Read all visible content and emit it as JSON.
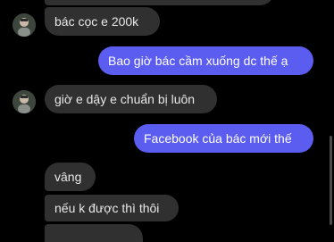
{
  "messages": [
    {
      "id": "m0",
      "dir": "in",
      "text": ""
    },
    {
      "id": "m1",
      "dir": "in",
      "text": "bác cọc e 200k"
    },
    {
      "id": "m2",
      "dir": "out",
      "text": "Bao giờ bác cầm xuống dc thế ạ"
    },
    {
      "id": "m3",
      "dir": "in",
      "text": "giờ e dậy e chuẩn bị luôn"
    },
    {
      "id": "m4",
      "dir": "out",
      "text": "Facebook của bác mới thế"
    },
    {
      "id": "m5",
      "dir": "in",
      "text": "vâng"
    },
    {
      "id": "m6",
      "dir": "in",
      "text": "nếu k được thì thôi"
    },
    {
      "id": "m7",
      "dir": "in",
      "text": ""
    }
  ],
  "colors": {
    "background": "#000000",
    "incoming_bubble": "#303030",
    "outgoing_bubble": "#5b5cf0"
  },
  "icons": {
    "contact_avatar": "avatar-icon"
  }
}
